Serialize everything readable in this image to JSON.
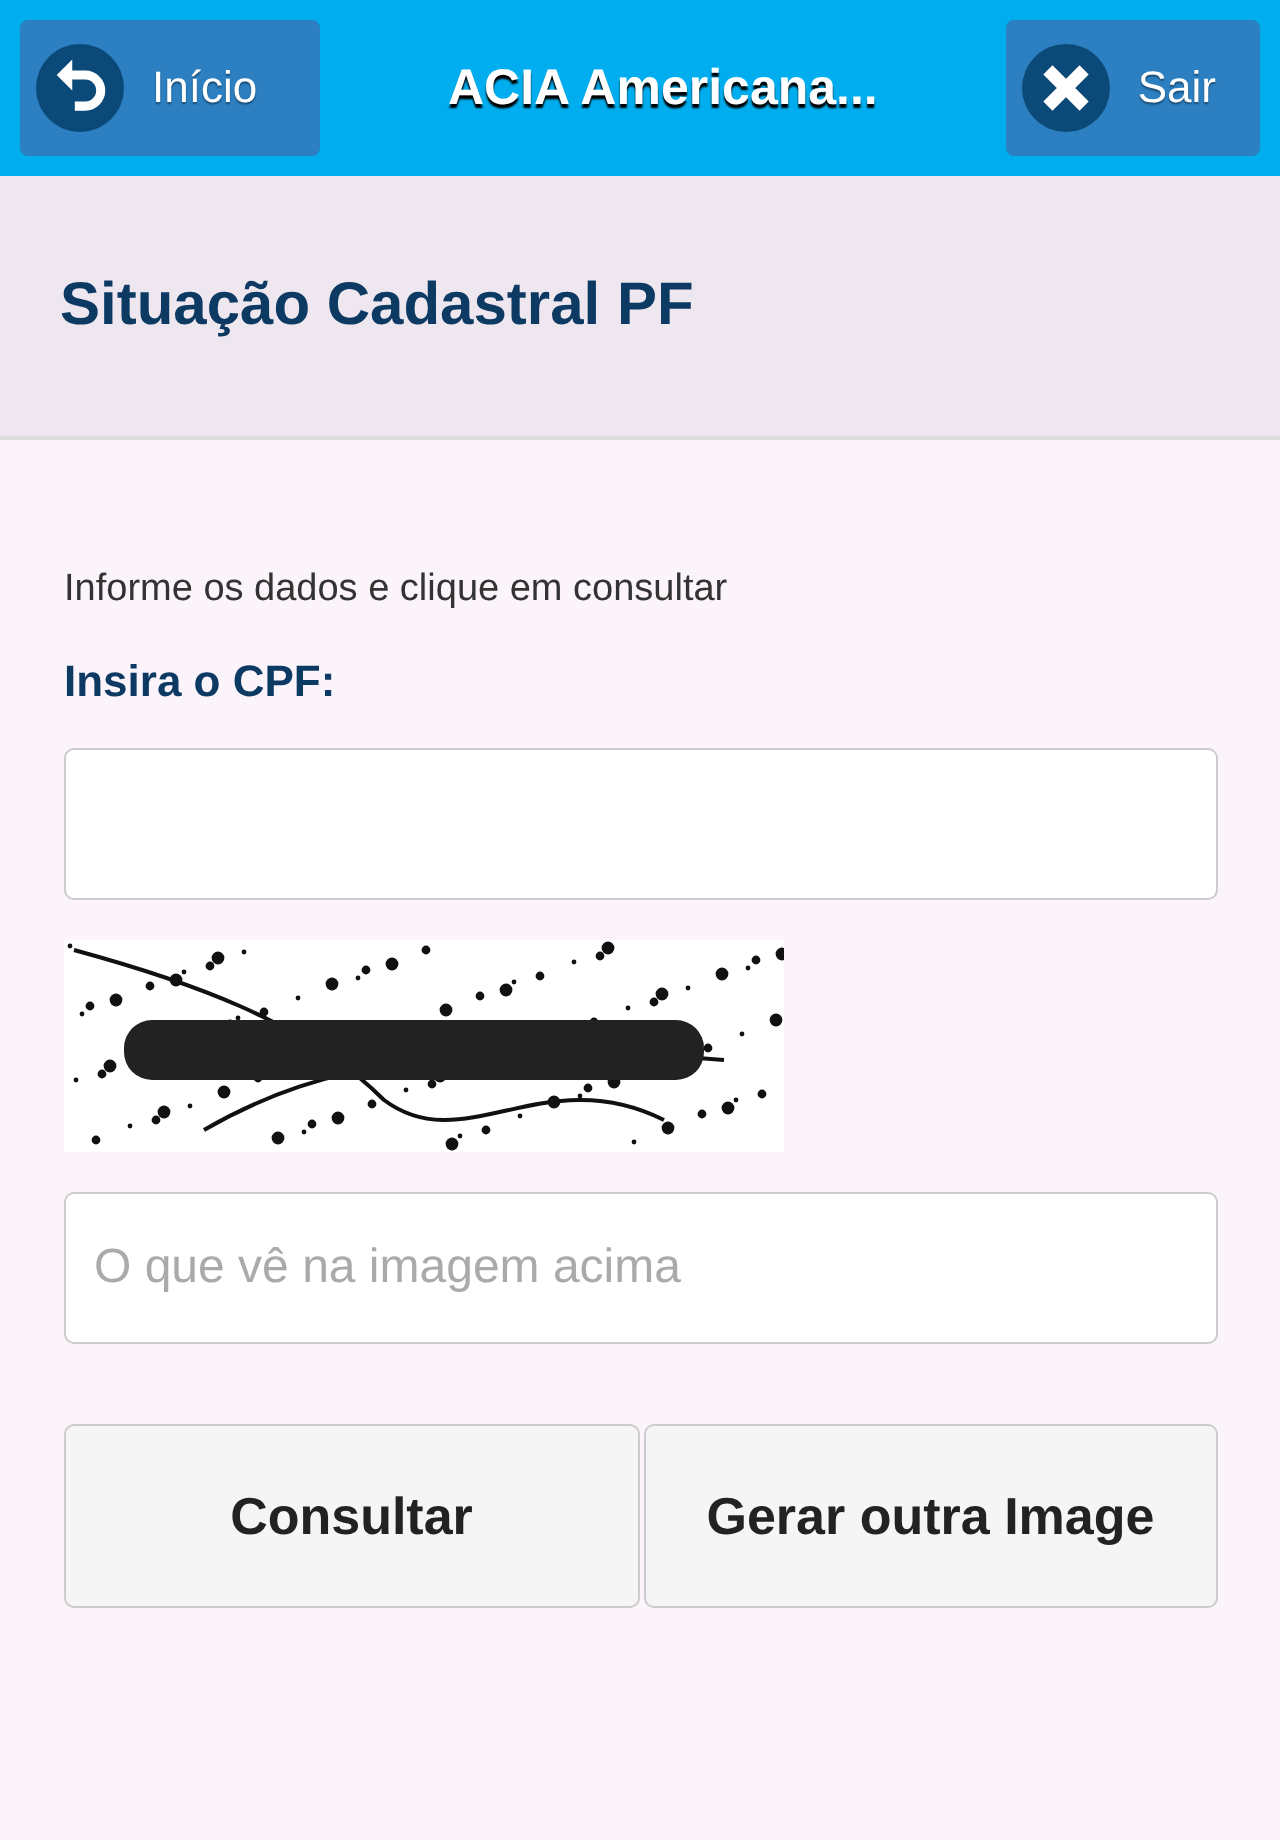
{
  "header": {
    "title": "ACIA Americana...",
    "left_button": {
      "label": "Início"
    },
    "right_button": {
      "label": "Sair"
    }
  },
  "page_title": "Situação Cadastral PF",
  "intro": "Informe os dados e clique em consultar",
  "cpf_label": "Insira o CPF:",
  "captcha_field": {
    "placeholder": "O que vê na imagem acima"
  },
  "buttons": [
    "Consultar",
    "Gerar outra Image"
  ]
}
